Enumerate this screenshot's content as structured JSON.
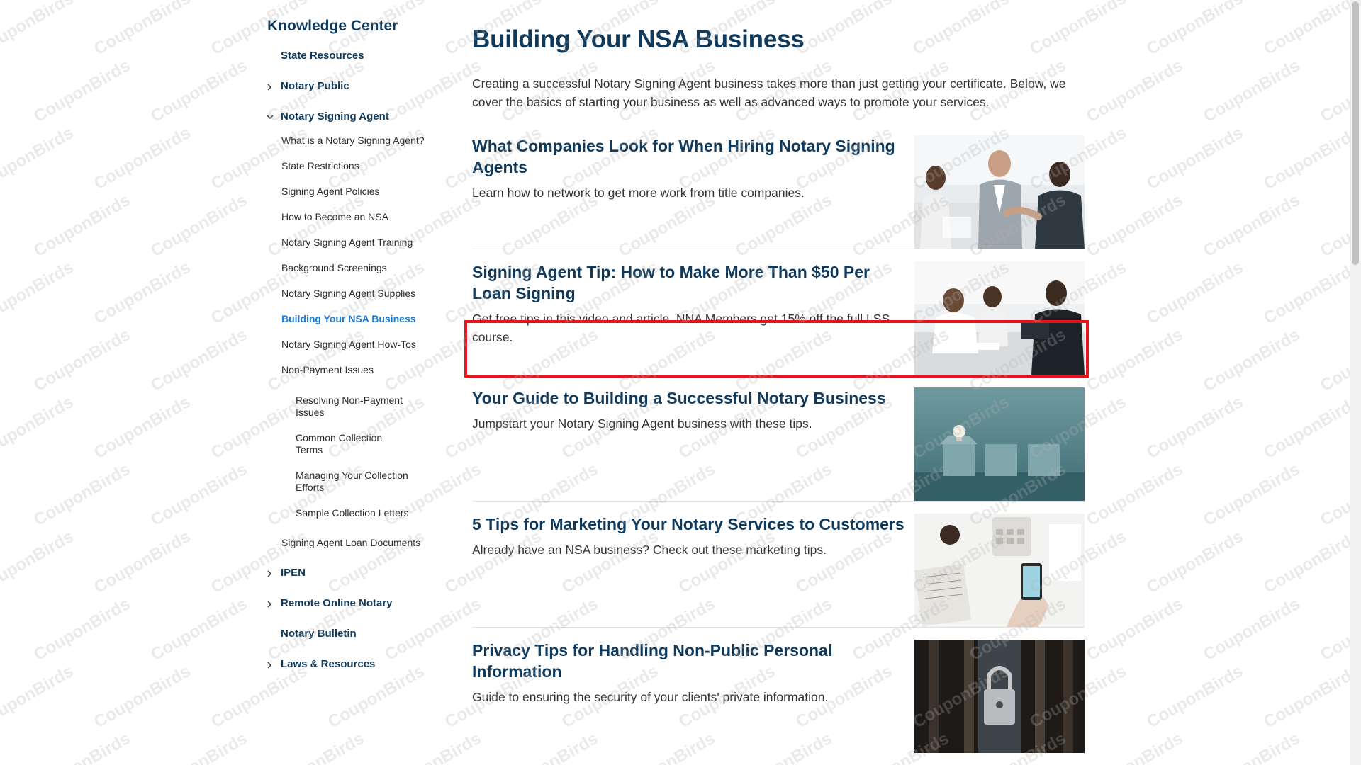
{
  "sidebar": {
    "title": "Knowledge Center",
    "items": [
      {
        "label": "State Resources"
      },
      {
        "label": "Notary Public"
      },
      {
        "label": "Notary Signing Agent"
      },
      {
        "label": "IPEN"
      },
      {
        "label": "Remote Online Notary"
      },
      {
        "label": "Notary Bulletin"
      },
      {
        "label": "Laws & Resources"
      }
    ],
    "nsa_children": [
      {
        "label": "What is a Notary Signing Agent?"
      },
      {
        "label": "State Restrictions"
      },
      {
        "label": "Signing Agent Policies"
      },
      {
        "label": "How to Become an NSA"
      },
      {
        "label": "Notary Signing Agent Training"
      },
      {
        "label": "Background Screenings"
      },
      {
        "label": "Notary Signing Agent Supplies"
      },
      {
        "label": "Building Your NSA Business"
      },
      {
        "label": "Notary Signing Agent How-Tos"
      },
      {
        "label": "Non-Payment Issues"
      },
      {
        "label": "Signing Agent Loan Documents"
      }
    ],
    "nonpayment_children": [
      {
        "label": "Resolving Non-Payment Issues"
      },
      {
        "label": "Common Collection Terms"
      },
      {
        "label": "Managing Your Collection Efforts"
      },
      {
        "label": "Sample Collection Letters"
      }
    ]
  },
  "main": {
    "title": "Building Your NSA Business",
    "intro": "Creating a successful Notary Signing Agent business takes more than just getting your certificate. Below, we cover the basics of starting your business as well as advanced ways to promote your services.",
    "articles": [
      {
        "title": "What Companies Look for When Hiring Notary Signing Agents",
        "desc": "Learn how to network to get more work from title companies."
      },
      {
        "title": "Signing Agent Tip: How to Make More Than $50 Per Loan Signing",
        "desc": "Get free tips in this video and article. NNA Members get 15% off the full LSS course."
      },
      {
        "title": "Your Guide to Building a Successful Notary Business",
        "desc": "Jumpstart your Notary Signing Agent business with these tips."
      },
      {
        "title": "5 Tips for Marketing Your Notary Services to Customers",
        "desc": "Already have an NSA business? Check out these marketing tips."
      },
      {
        "title": "Privacy Tips for Handling Non-Public Personal Information",
        "desc": "Guide to ensuring the security of your clients' private information."
      }
    ]
  },
  "watermark": "CouponBirds",
  "colors": {
    "heading": "#0f3a5c",
    "active_link": "#1f7ad1",
    "highlight": "#e8131c"
  }
}
